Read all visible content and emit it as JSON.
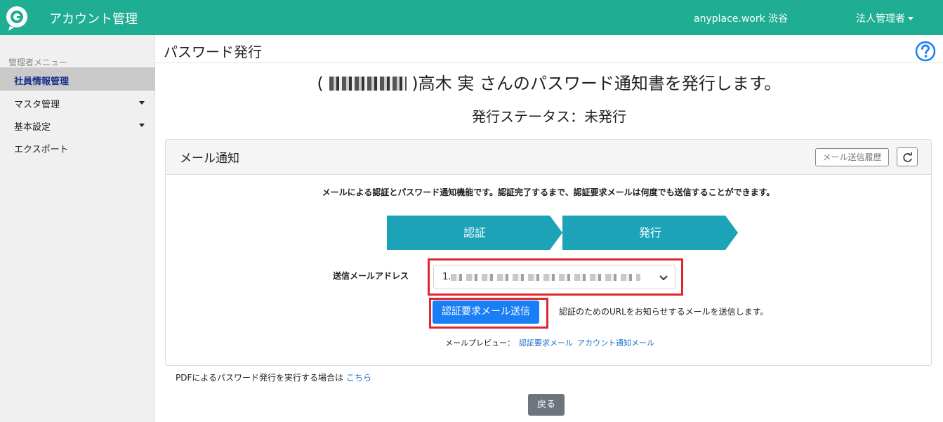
{
  "header": {
    "app_title": "アカウント管理",
    "workspace": "anyplace.work 渋谷",
    "user_menu": "法人管理者",
    "brand_color": "#1fae93"
  },
  "sidebar": {
    "heading": "管理者メニュー",
    "items": [
      {
        "label": "社員情報管理",
        "active": true
      },
      {
        "label": "マスタ管理",
        "has_submenu": true
      },
      {
        "label": "基本設定",
        "has_submenu": true
      },
      {
        "label": "エクスポート"
      }
    ]
  },
  "page": {
    "title": "パスワード発行",
    "help_icon": "question-circle-icon",
    "headline_prefix": "(",
    "headline_suffix": ")高木 実 さんのパスワード通知書を発行します。",
    "status": "発行ステータス：未発行"
  },
  "mail_card": {
    "title": "メール通知",
    "history_button": "メール送信履歴",
    "refresh_icon": "refresh-icon",
    "description": "メールによる認証とパスワード通知機能です。認証完了するまで、認証要求メールは何度でも送信することができます。",
    "steps": [
      "認証",
      "発行"
    ],
    "step_color": "#1ca3b8",
    "address_label": "送信メールアドレス",
    "address_value_prefix": "1.",
    "send_button": "認証要求メール送信",
    "send_note": "認証のためのURLをお知らせするメールを送信します。",
    "preview_label": "メールプレビュー：",
    "preview_links": [
      "認証要求メール",
      "アカウント通知メール"
    ]
  },
  "pdf": {
    "note": "PDFによるパスワード発行を実行する場合は",
    "link": "こちら"
  },
  "back_button": "戻る",
  "highlight_color": "#e0262e"
}
